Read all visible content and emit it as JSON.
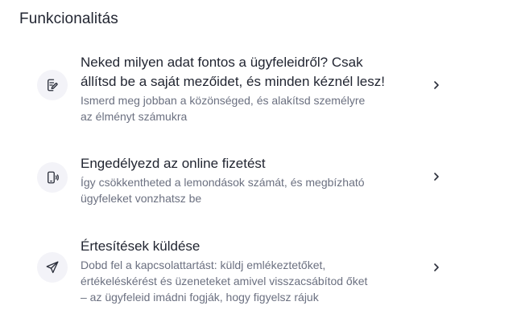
{
  "section": {
    "title": "Funkcionalitás"
  },
  "features": [
    {
      "icon": "edit-form-icon",
      "title": "Neked milyen adat fontos a ügyfeleidről? Csak\nállítsd be a saját mezőidet, és minden kéznél lesz!",
      "description": "Ismerd meg jobban a közönséged, és alakítsd személyre\naz élményt számukra"
    },
    {
      "icon": "mobile-payment-icon",
      "title": "Engedélyezd az online fizetést",
      "description": "Így csökkentheted a lemondások számát, és megbízható\nügyfeleket vonzhatsz be"
    },
    {
      "icon": "send-icon",
      "title": "Értesítések küldése",
      "description": "Dobd fel a kapcsolattartást: küldj emlékeztetőket,\nértékeléskérést és üzeneteket amivel visszacsábítod őket\n– az ügyfeleid imádni fogják, hogy figyelsz rájuk"
    }
  ],
  "colors": {
    "icon_bg": "#f3f3f8",
    "title_text": "#222632",
    "desc_text": "#6b7080",
    "icon_stroke": "#2a2e3a"
  },
  "chevron_icon": "chevron-right-icon"
}
